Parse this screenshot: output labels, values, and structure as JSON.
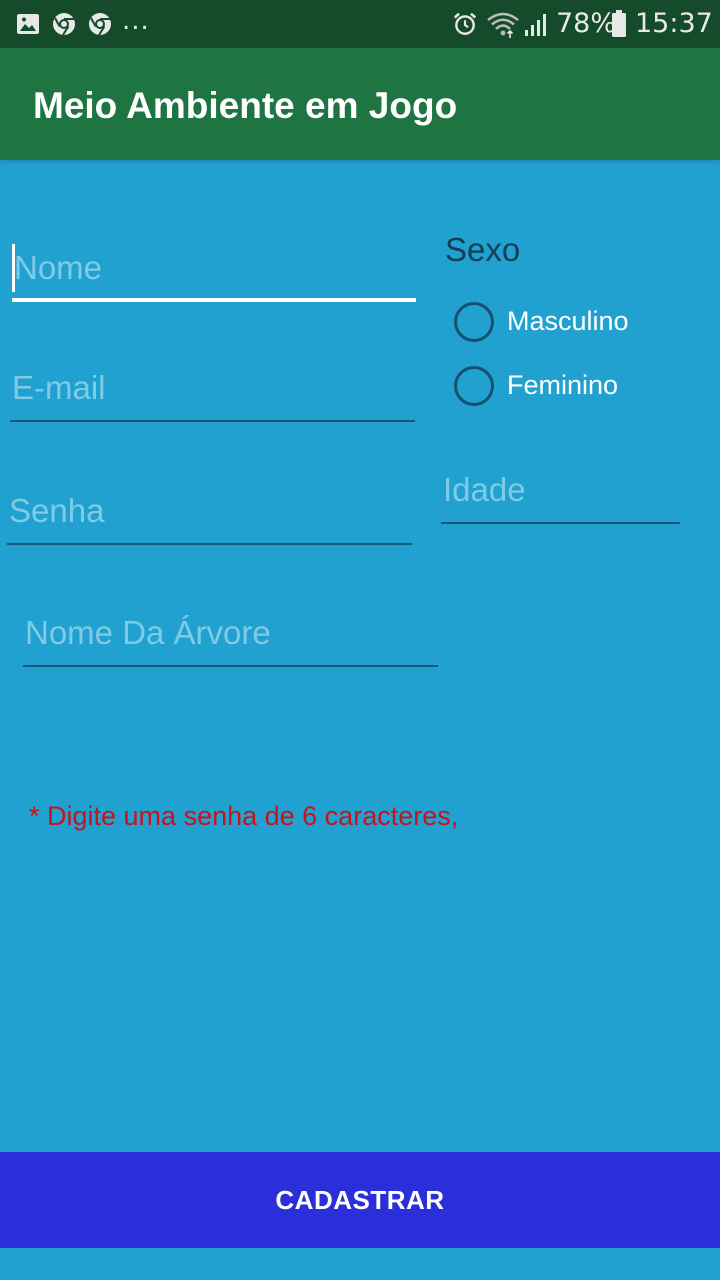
{
  "status_bar": {
    "icons": [
      "image-icon",
      "chrome-icon",
      "chrome-icon",
      "alarm-icon",
      "wifi-icon",
      "signal-icon",
      "battery-icon"
    ],
    "overflow": "...",
    "battery": "78%",
    "time": "15:37"
  },
  "app_bar": {
    "title": "Meio Ambiente em Jogo",
    "color": "#1e7541"
  },
  "form": {
    "nome": {
      "placeholder": "Nome",
      "value": ""
    },
    "email": {
      "placeholder": "E-mail",
      "value": ""
    },
    "senha": {
      "placeholder": "Senha",
      "value": ""
    },
    "idade": {
      "placeholder": "Idade",
      "value": ""
    },
    "arvore": {
      "placeholder": "Nome Da Árvore",
      "value": ""
    },
    "sexo": {
      "label": "Sexo",
      "options": [
        {
          "label": "Masculino",
          "selected": false
        },
        {
          "label": "Feminino",
          "selected": false
        }
      ]
    }
  },
  "warning": "* Digite uma senha de 6 caracteres,",
  "button": {
    "label": "CADASTRAR",
    "color": "#2a2fd9"
  },
  "colors": {
    "background": "#21a1cf",
    "status_bar": "#154a2a",
    "warning": "#c8121c"
  }
}
